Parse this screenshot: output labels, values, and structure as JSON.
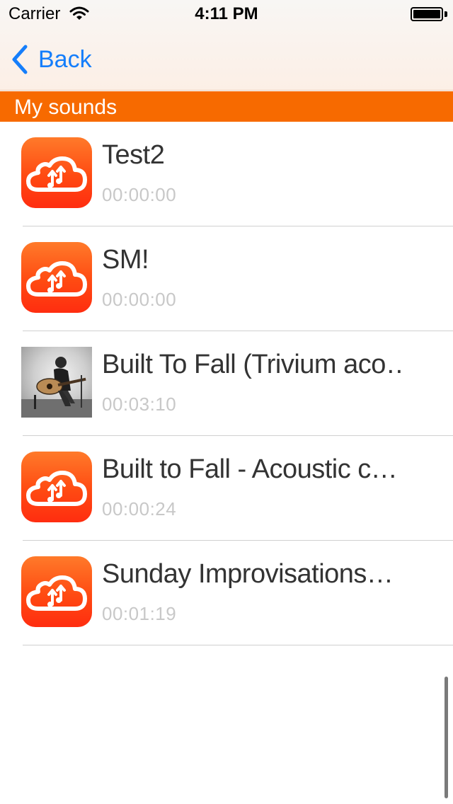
{
  "status_bar": {
    "carrier": "Carrier",
    "time": "4:11 PM"
  },
  "nav": {
    "back_label": "Back",
    "accent_color": "#157efb"
  },
  "section": {
    "title": "My sounds",
    "color": "#f76a00"
  },
  "sounds": [
    {
      "title": "Test2",
      "duration": "00:00:00",
      "thumbnail": "cloud-music-icon"
    },
    {
      "title": "SM!",
      "duration": "00:00:00",
      "thumbnail": "cloud-music-icon"
    },
    {
      "title": "Built To Fall (Trivium aco…",
      "duration": "00:03:10",
      "thumbnail": "guitar-player-photo"
    },
    {
      "title": "Built to Fall - Acoustic c…",
      "duration": "00:00:24",
      "thumbnail": "cloud-music-icon"
    },
    {
      "title": "Sunday Improvisations…",
      "duration": "00:01:19",
      "thumbnail": "cloud-music-icon"
    }
  ]
}
